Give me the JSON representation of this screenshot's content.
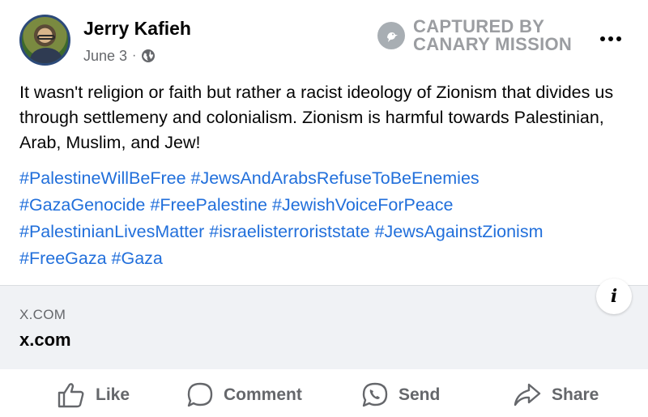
{
  "post": {
    "author": "Jerry Kafieh",
    "date": "June 3",
    "separator": "·",
    "privacy_icon": "globe-icon",
    "body": "It wasn't religion or faith but rather a racist ideology of Zionism that divides us through settlemeny and colonialism.  Zionism is harmful towards Palestinian, Arab, Muslim, and Jew!",
    "hashtags": [
      "#PalestineWillBeFree",
      "#JewsAndArabsRefuseToBeEnemies",
      "#GazaGenocide",
      "#FreePalestine",
      "#JewishVoiceForPeace",
      "#PalestinianLivesMatter",
      "#israelisterroriststate",
      "#JewsAgainstZionism",
      "#FreeGaza",
      "#Gaza"
    ]
  },
  "watermark": {
    "line1": "CAPTURED BY",
    "line2": "CANARY MISSION",
    "icon": "canary-icon"
  },
  "link_preview": {
    "domain": "X.COM",
    "title": "x.com"
  },
  "actions": {
    "like": "Like",
    "comment": "Comment",
    "send": "Send",
    "share": "Share"
  },
  "colors": {
    "hashtag": "#216fdb",
    "secondary_text": "#65676b",
    "preview_bg": "#f0f2f5"
  }
}
